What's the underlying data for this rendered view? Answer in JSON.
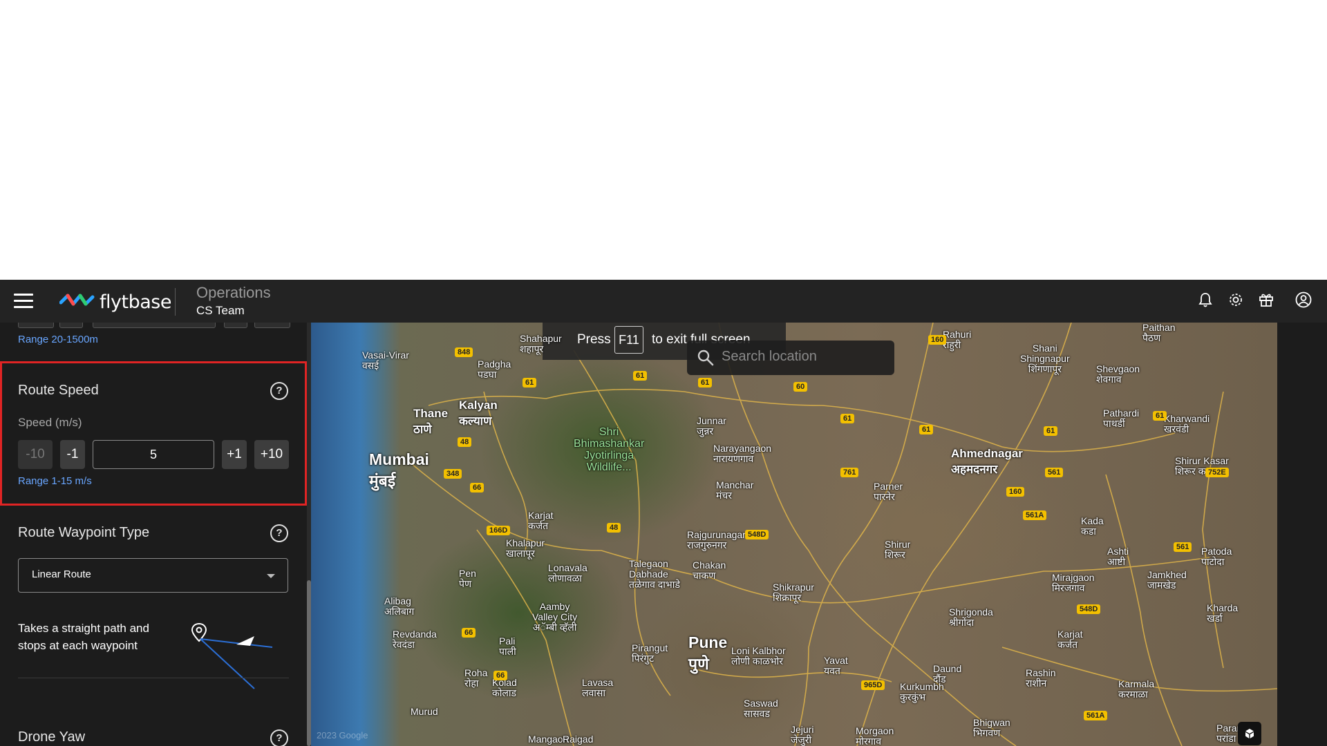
{
  "header": {
    "brand": "flytbase",
    "section_title": "Operations",
    "team_name": "CS Team"
  },
  "sidebar": {
    "altitude_range": "Range 20-1500m",
    "route_speed": {
      "title": "Route Speed",
      "help": "?",
      "label": "Speed (m/s)",
      "minus10": "-10",
      "minus1": "-1",
      "value": "5",
      "plus1": "+1",
      "plus10": "+10",
      "range": "Range 1-15 m/s"
    },
    "waypoint_type": {
      "title": "Route Waypoint Type",
      "help": "?",
      "selected": "Linear Route",
      "description": "Takes a straight path and stops at each waypoint"
    },
    "drone_yaw": {
      "title": "Drone Yaw",
      "help": "?"
    }
  },
  "map": {
    "fullscreen_press": "Press",
    "fullscreen_key": "F11",
    "fullscreen_suffix": "to exit full screen",
    "search_placeholder": "Search location",
    "copyright": "2023 Google",
    "labels": {
      "mumbai": "Mumbai",
      "mumbai_local": "मुंबई",
      "thane": "Thane",
      "thane_local": "ठाणे",
      "kalyan": "Kalyan",
      "kalyan_local": "कल्याण",
      "pune": "Pune",
      "pune_local": "पुणे",
      "ahmednagar": "Ahmednagar",
      "ahmednagar_local": "अहमदनगर",
      "vasai": "Vasai-Virar",
      "vasai_local": "वसई",
      "padgha": "Padgha",
      "padgha_local": "पडघा",
      "shahapur": "Shahapur",
      "shahapur_local": "शहापूर",
      "shri": "Shri",
      "bhimashankar": "Bhimashankar",
      "jyotirlinga": "Jyotirlinga",
      "wildlife": "Wildlife...",
      "junnar": "Junnar",
      "junnar_local": "जुन्नर",
      "narayangaon": "Narayangaon",
      "narayangaon_local": "नारायणगाव",
      "manchar": "Manchar",
      "manchar_local": "मंचर",
      "parner": "Parner",
      "parner_local": "पारनेर",
      "rahuri": "Rahuri",
      "rahuri_local": "राहुरी",
      "shani": "Shani",
      "shingnapur": "Shingnapur",
      "shingnapur_local": "शिंगणापूर",
      "shevgaon": "Shevgaon",
      "shevgaon_local": "शेवगाव",
      "paithan": "Paithan",
      "paithan_local": "पैठण",
      "pathardi": "Pathardi",
      "pathardi_local": "पाथर्डी",
      "kharwandi": "Kharwandi",
      "kharwandi_local": "खरवंडी",
      "shirur_kasar": "Shirur Kasar",
      "shirur_kasar_local": "शिरूर कसार",
      "kada": "Kada",
      "kada_local": "कडा",
      "ashti": "Ashti",
      "ashti_local": "आष्टी",
      "patoda": "Patoda",
      "patoda_local": "पाटोदा",
      "jamkhed": "Jamkhed",
      "jamkhed_local": "जामखेड",
      "mirajgaon": "Mirajgaon",
      "mirajgaon_local": "मिरजगाव",
      "kharda": "Kharda",
      "kharda_local": "खर्डा",
      "karjat": "Karjat",
      "karjat_local": "कर्जत",
      "shrigonda": "Shrigonda",
      "shrigonda_local": "श्रीगोंदा",
      "shirur": "Shirur",
      "shirur_local": "शिरूर",
      "rajgurunagar": "Rajgurunagar",
      "rajgurunagar_local": "राजगुरुनगर",
      "chakan": "Chakan",
      "chakan_local": "चाकण",
      "shikrapur": "Shikrapur",
      "shikrapur_local": "शिक्रापूर",
      "talegaon": "Talegaon",
      "dabhade": "Dabhade",
      "dabhade_local": "तळेगाव दाभाडे",
      "lonavala": "Lonavala",
      "lonavala_local": "लोणावळा",
      "khalapur": "Khalapur",
      "khalapur_local": "खालापूर",
      "karjat_w": "Karjat",
      "karjat_w_local": "कर्जत",
      "pen": "Pen",
      "pen_local": "पेण",
      "alibag": "Alibag",
      "alibag_local": "अलिबाग",
      "revdanda": "Revdanda",
      "revdanda_local": "रेवदंडा",
      "aamby": "Aamby",
      "aamby_valley": "Valley City",
      "aamby_local": "अॅम्बी व्हॅली",
      "pali": "Pali",
      "pali_local": "पाली",
      "pirangut": "Pirangut",
      "pirangut_local": "पिरंगुट",
      "loni": "Loni Kalbhor",
      "loni_local": "लोणी काळभोर",
      "yavat": "Yavat",
      "yavat_local": "यवत",
      "daund": "Daund",
      "daund_local": "दौंड",
      "kurkumbh": "Kurkumbh",
      "kurkumbh_local": "कुरकुंभ",
      "rashin": "Rashin",
      "rashin_local": "राशीन",
      "karmala": "Karmala",
      "karmala_local": "करमाळा",
      "bhigwan": "Bhigwan",
      "bhigwan_local": "भिगवण",
      "saswad": "Saswad",
      "saswad_local": "सासवड",
      "jejuri": "Jejuri",
      "jejuri_local": "जेजुरी",
      "morgaon": "Morgaon",
      "morgaon_local": "मोरगाव",
      "roha": "Roha",
      "roha_local": "रोहा",
      "kolad": "Kolad",
      "kolad_local": "कोलाड",
      "lavasa": "Lavasa",
      "lavasa_local": "लवासा",
      "murud": "Murud",
      "mangaon": "Mangaon",
      "raigad": "Raigad",
      "paranda": "Paranda",
      "paranda_local": "परांडा"
    },
    "shields": [
      "160",
      "848",
      "61",
      "61",
      "61",
      "60",
      "61",
      "61",
      "61",
      "48",
      "348",
      "66",
      "166D",
      "48",
      "548D",
      "761",
      "160",
      "561A",
      "561",
      "752E",
      "561",
      "61",
      "548D",
      "66",
      "66",
      "965D",
      "561A"
    ]
  }
}
